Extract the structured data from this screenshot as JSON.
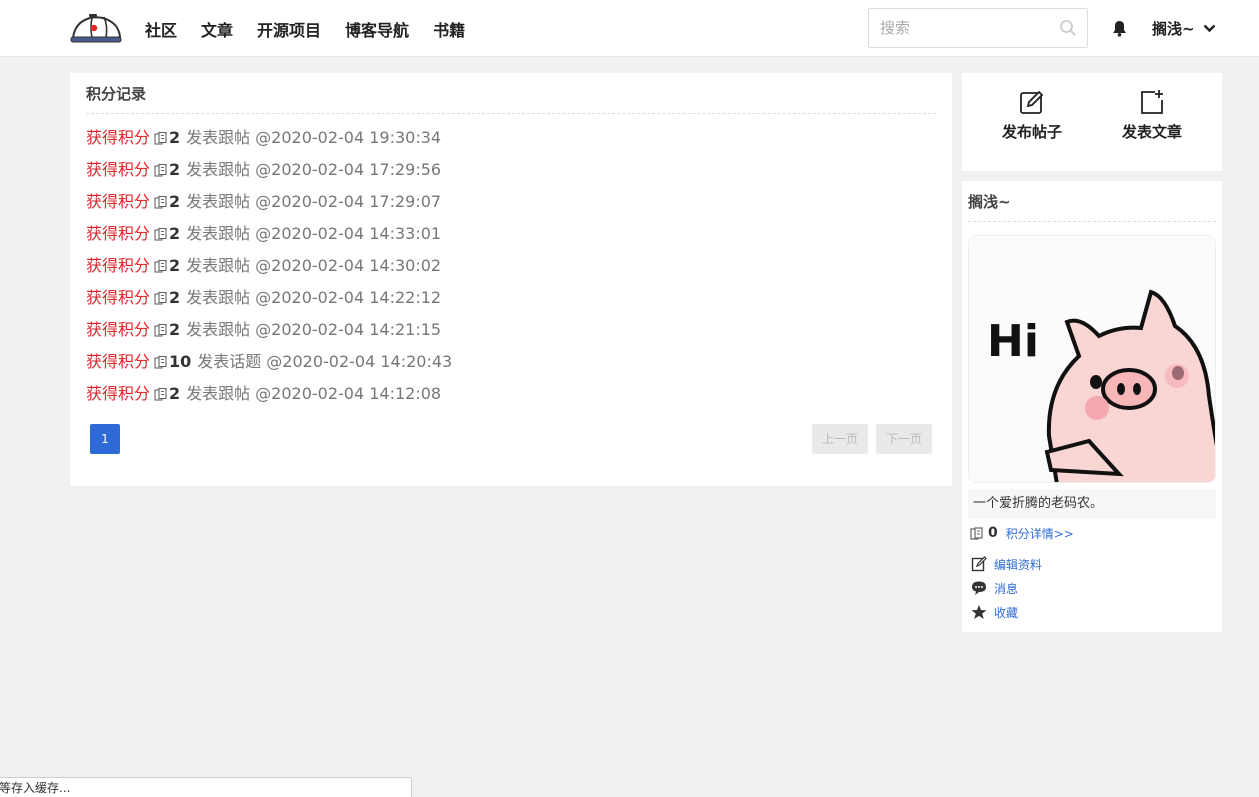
{
  "header": {
    "logo_icon": "cap-logo-icon",
    "nav": [
      "社区",
      "文章",
      "开源项目",
      "博客导航",
      "书籍"
    ],
    "search_placeholder": "搜索",
    "username": "搁浅~"
  },
  "records_card": {
    "title": "积分记录",
    "gain_label": "获得积分",
    "items": [
      {
        "points": "2",
        "action": "发表跟帖",
        "time": "@2020-02-04 19:30:34"
      },
      {
        "points": "2",
        "action": "发表跟帖",
        "time": "@2020-02-04 17:29:56"
      },
      {
        "points": "2",
        "action": "发表跟帖",
        "time": "@2020-02-04 17:29:07"
      },
      {
        "points": "2",
        "action": "发表跟帖",
        "time": "@2020-02-04 14:33:01"
      },
      {
        "points": "2",
        "action": "发表跟帖",
        "time": "@2020-02-04 14:30:02"
      },
      {
        "points": "2",
        "action": "发表跟帖",
        "time": "@2020-02-04 14:22:12"
      },
      {
        "points": "2",
        "action": "发表跟帖",
        "time": "@2020-02-04 14:21:15"
      },
      {
        "points": "10",
        "action": "发表话题",
        "time": "@2020-02-04 14:20:43"
      },
      {
        "points": "2",
        "action": "发表跟帖",
        "time": "@2020-02-04 14:12:08"
      }
    ],
    "pagination": {
      "current": "1",
      "prev": "上一页",
      "next": "下一页"
    }
  },
  "actions": {
    "post_topic": "发布帖子",
    "post_article": "发表文章"
  },
  "profile": {
    "name": "搁浅~",
    "avatar_text": "Hi",
    "bio": "一个爱折腾的老码农。",
    "points": "0",
    "points_link": "积分详情>>",
    "menu": {
      "edit": "编辑资料",
      "messages": "消息",
      "favorites": "收藏"
    }
  },
  "status": "等存入缓存...",
  "colors": {
    "accent": "#2f6bd8",
    "gain": "#e3262c",
    "background": "#f1f1f1"
  }
}
